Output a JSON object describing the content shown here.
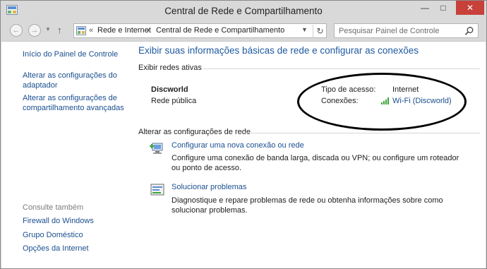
{
  "window": {
    "title": "Central de Rede e Compartilhamento",
    "controls": {
      "minimize": "—",
      "maximize": "□",
      "close": "✕"
    }
  },
  "navigation": {
    "back_icon": "back-arrow-icon",
    "forward_icon": "forward-arrow-icon",
    "chevron": "«",
    "breadcrumbs": [
      "Rede e Internet",
      "Central de Rede e Compartilhamento"
    ],
    "separator": "›",
    "search_placeholder": "Pesquisar Painel de Controle"
  },
  "sidebar": {
    "links": [
      "Início do Painel de Controle",
      "Alterar as configurações do adaptador",
      "Alterar as configurações de compartilhamento avançadas"
    ],
    "see_also_heading": "Consulte também",
    "see_also": [
      "Firewall do Windows",
      "Grupo Doméstico",
      "Opções da Internet"
    ]
  },
  "main": {
    "title": "Exibir suas informações básicas de rede e configurar as conexões",
    "active_networks_label": "Exibir redes ativas",
    "network": {
      "name": "Discworld",
      "type": "Rede pública",
      "access_type_label": "Tipo de acesso:",
      "access_type_value": "Internet",
      "connections_label": "Conexões:",
      "connections_value": "Wi-Fi (Discworld)"
    },
    "change_settings_label": "Alterar as configurações de rede",
    "tasks": [
      {
        "title": "Configurar uma nova conexão ou rede",
        "description": "Configure uma conexão de banda larga, discada ou VPN; ou configure um roteador ou ponto de acesso."
      },
      {
        "title": "Solucionar problemas",
        "description": "Diagnostique e repare problemas de rede ou obtenha informações sobre como solucionar problemas."
      }
    ]
  },
  "colors": {
    "link": "#1a4f8f",
    "title_blue": "#1f5aa0",
    "close_red": "#c7413a",
    "chrome": "#d9d9d9"
  }
}
